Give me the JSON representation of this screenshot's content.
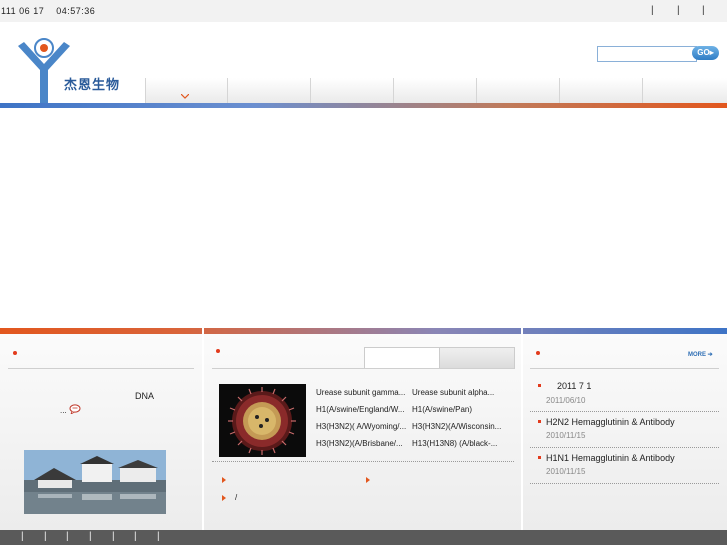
{
  "topbar": {
    "date": "111 06 17",
    "time": "04:57:36",
    "separators": [
      "|",
      "|",
      "|"
    ]
  },
  "header": {
    "brand": "杰恩生物",
    "search": {
      "value": "",
      "placeholder": ""
    },
    "go_label": "GO"
  },
  "nav": {
    "items": [
      "",
      "",
      "",
      "",
      "",
      "",
      ""
    ]
  },
  "left_panel": {
    "title": "",
    "intro_text": "DNA",
    "more_label": "..."
  },
  "middle_panel": {
    "tabs": [
      "",
      ""
    ],
    "products": [
      [
        "Urease subunit gamma...",
        "Urease subunit alpha..."
      ],
      [
        "H1(A/swine/England/W...",
        "H1(A/swine/Pan)"
      ],
      [
        "H3(H3N2)( A/Wyoming/...",
        "H3(H3N2)(A/Wisconsin..."
      ],
      [
        "H3(H3N2)(A/Brisbane/...",
        "H13(H13N8) (A/black-..."
      ]
    ],
    "links": [
      "",
      "",
      "/"
    ]
  },
  "right_panel": {
    "more_label": "MORE",
    "news": [
      {
        "title": "2011 7 1",
        "date": "2011/06/10"
      },
      {
        "title": "H2N2 Hemagglutinin & Antibody",
        "date": "2010/11/15"
      },
      {
        "title": "H1N1 Hemagglutinin & Antibody",
        "date": "2010/11/15"
      }
    ]
  },
  "footer": {
    "separators": [
      "|",
      "|",
      "|",
      "|",
      "|",
      "|",
      "|"
    ]
  },
  "colors": {
    "accent_orange": "#e2571e",
    "accent_blue": "#3e74c6",
    "bullet_red": "#e23b1d",
    "brand_blue": "#2a5b9a",
    "footer_gray": "#5a5a5a"
  },
  "icons": [
    "search-go-icon",
    "chevron-down-icon",
    "speech-bubble-icon",
    "bullet-dot-icon",
    "arrow-bullet-icon",
    "more-arrow-icon"
  ]
}
